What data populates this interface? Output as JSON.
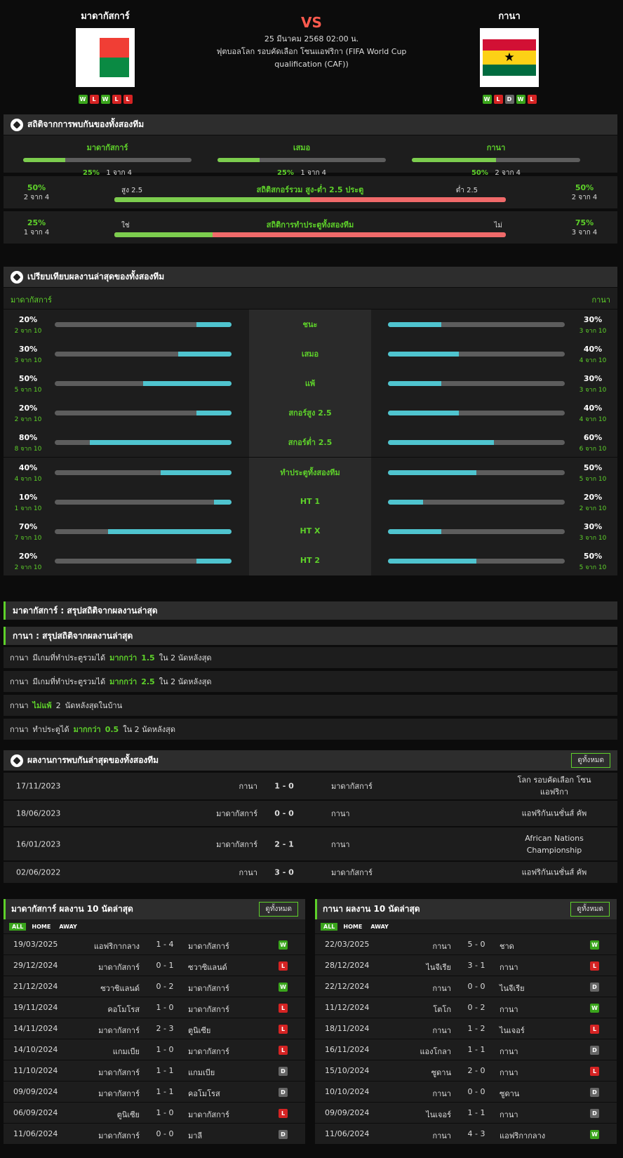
{
  "match": {
    "vs": "VS",
    "date": "25 มีนาคม 2568 02:00 น.",
    "competition": "ฟุตบอลโลก รอบคัดเลือก โซนแอฟริกา (FIFA World Cup qualification (CAF))",
    "home": {
      "name": "มาดากัสการ์",
      "form": [
        "W",
        "L",
        "W",
        "L",
        "L"
      ],
      "colors": [
        "#ffffff",
        "#f03e35",
        "#0a8a43"
      ]
    },
    "away": {
      "name": "กานา",
      "form": [
        "W",
        "L",
        "D",
        "W",
        "L"
      ],
      "colors": [
        "#d21034",
        "#fcd116",
        "#006b3f"
      ]
    }
  },
  "h2h_stats": {
    "title": "สถิติจากการพบกันของทั้งสองทีม",
    "cols": [
      {
        "label": "มาดากัสการ์",
        "pct": "25%",
        "frac": "1 จาก 4",
        "value": 25
      },
      {
        "label": "เสมอ",
        "pct": "25%",
        "frac": "1 จาก 4",
        "value": 25
      },
      {
        "label": "กานา",
        "pct": "50%",
        "frac": "2 จาก 4",
        "value": 50
      }
    ],
    "ou": {
      "title": "สถิติสกอร์รวม สูง-ต่ำ 2.5 ประตู",
      "left_label": "สูง 2.5",
      "right_label": "ต่ำ 2.5",
      "lp": "50%",
      "lf": "2 จาก 4",
      "rp": "50%",
      "rf": "2 จาก 4",
      "value": 50
    },
    "btts": {
      "title": "สถิติการทำประตูทั้งสองทีม",
      "left_label": "ใช่",
      "right_label": "ไม่",
      "lp": "25%",
      "lf": "1 จาก 4",
      "rp": "75%",
      "rf": "3 จาก 4",
      "value": 25
    }
  },
  "compare": {
    "title": "เปรียบเทียบผลงานล่าสุดของทั้งสองทีม",
    "home": "มาดากัสการ์",
    "away": "กานา",
    "rows": [
      {
        "label": "ชนะ",
        "lp": "20%",
        "lf": "2 จาก 10",
        "lv": 20,
        "rp": "30%",
        "rf": "3 จาก 10",
        "rv": 30
      },
      {
        "label": "เสมอ",
        "lp": "30%",
        "lf": "3 จาก 10",
        "lv": 30,
        "rp": "40%",
        "rf": "4 จาก 10",
        "rv": 40
      },
      {
        "label": "แพ้",
        "lp": "50%",
        "lf": "5 จาก 10",
        "lv": 50,
        "rp": "30%",
        "rf": "3 จาก 10",
        "rv": 30
      },
      {
        "label": "สกอร์สูง 2.5",
        "lp": "20%",
        "lf": "2 จาก 10",
        "lv": 20,
        "rp": "40%",
        "rf": "4 จาก 10",
        "rv": 40
      },
      {
        "label": "สกอร์ต่ำ 2.5",
        "lp": "80%",
        "lf": "8 จาก 10",
        "lv": 80,
        "rp": "60%",
        "rf": "6 จาก 10",
        "rv": 60
      },
      {
        "label": "ทำประตูทั้งสองทีม",
        "lp": "40%",
        "lf": "4 จาก 10",
        "lv": 40,
        "rp": "50%",
        "rf": "5 จาก 10",
        "rv": 50
      },
      {
        "label": "HT 1",
        "lp": "10%",
        "lf": "1 จาก 10",
        "lv": 10,
        "rp": "20%",
        "rf": "2 จาก 10",
        "rv": 20
      },
      {
        "label": "HT X",
        "lp": "70%",
        "lf": "7 จาก 10",
        "lv": 70,
        "rp": "30%",
        "rf": "3 จาก 10",
        "rv": 30
      },
      {
        "label": "HT 2",
        "lp": "20%",
        "lf": "2 จาก 10",
        "lv": 20,
        "rp": "50%",
        "rf": "5 จาก 10",
        "rv": 50
      }
    ]
  },
  "summary": {
    "home_title": "มาดากัสการ์ : สรุปสถิติจากผลงานล่าสุด",
    "away_title": "กานา : สรุปสถิติจากผลงานล่าสุด",
    "rows": [
      [
        "กานา",
        "มีเกมที่ทำประตูรวมได้",
        "มากกว่า",
        "1.5",
        "ใน 2 นัดหลังสุด"
      ],
      [
        "กานา",
        "มีเกมที่ทำประตูรวมได้",
        "มากกว่า",
        "2.5",
        "ใน 2 นัดหลังสุด"
      ],
      [
        "กานา",
        "",
        "ไม่แพ้",
        "2",
        "นัดหลังสุดในบ้าน"
      ],
      [
        "กานา",
        "ทำประตูได้",
        "มากกว่า",
        "0.5",
        "ใน 2 นัดหลังสุด"
      ]
    ]
  },
  "h2h_results": {
    "title": "ผลงานการพบกันล่าสุดของทั้งสองทีม",
    "view_all": "ดูทั้งหมด",
    "rows": [
      {
        "date": "17/11/2023",
        "home": "กานา",
        "score": "1 - 0",
        "away": "มาดากัสการ์",
        "comp": "โลก รอบคัดเลือก โซนแอฟริกา"
      },
      {
        "date": "18/06/2023",
        "home": "มาดากัสการ์",
        "score": "0 - 0",
        "away": "กานา",
        "comp": "แอฟริกันเนชั่นส์ คัพ"
      },
      {
        "date": "16/01/2023",
        "home": "มาดากัสการ์",
        "score": "2 - 1",
        "away": "กานา",
        "comp": "African Nations Championship"
      },
      {
        "date": "02/06/2022",
        "home": "กานา",
        "score": "3 - 0",
        "away": "มาดากัสการ์",
        "comp": "แอฟริกันเนชั่นส์ คัพ"
      }
    ]
  },
  "last10_home": {
    "title": "มาดากัสการ์ ผลงาน 10 นัดล่าสุด",
    "view_all": "ดูทั้งหมด",
    "tabs": [
      "ALL",
      "HOME",
      "AWAY"
    ],
    "rows": [
      [
        "19/03/2025",
        "แอฟริกากลาง",
        "1 - 4",
        "มาดากัสการ์",
        "W"
      ],
      [
        "29/12/2024",
        "มาดากัสการ์",
        "0 - 1",
        "ซวาซิแลนด์",
        "L"
      ],
      [
        "21/12/2024",
        "ซวาซิแลนด์",
        "0 - 2",
        "มาดากัสการ์",
        "W"
      ],
      [
        "19/11/2024",
        "คอโมโรส",
        "1 - 0",
        "มาดากัสการ์",
        "L"
      ],
      [
        "14/11/2024",
        "มาดากัสการ์",
        "2 - 3",
        "ตูนิเซีย",
        "L"
      ],
      [
        "14/10/2024",
        "แกมเบีย",
        "1 - 0",
        "มาดากัสการ์",
        "L"
      ],
      [
        "11/10/2024",
        "มาดากัสการ์",
        "1 - 1",
        "แกมเบีย",
        "D"
      ],
      [
        "09/09/2024",
        "มาดากัสการ์",
        "1 - 1",
        "คอโมโรส",
        "D"
      ],
      [
        "06/09/2024",
        "ตูนิเซีย",
        "1 - 0",
        "มาดากัสการ์",
        "L"
      ],
      [
        "11/06/2024",
        "มาดากัสการ์",
        "0 - 0",
        "มาลี",
        "D"
      ]
    ]
  },
  "last10_away": {
    "title": "กานา ผลงาน 10 นัดล่าสุด",
    "view_all": "ดูทั้งหมด",
    "tabs": [
      "ALL",
      "HOME",
      "AWAY"
    ],
    "rows": [
      [
        "22/03/2025",
        "กานา",
        "5 - 0",
        "ชาด",
        "W"
      ],
      [
        "28/12/2024",
        "ไนจีเรีย",
        "3 - 1",
        "กานา",
        "L"
      ],
      [
        "22/12/2024",
        "กานา",
        "0 - 0",
        "ไนจีเรีย",
        "D"
      ],
      [
        "11/12/2024",
        "โตโก",
        "0 - 2",
        "กานา",
        "W"
      ],
      [
        "18/11/2024",
        "กานา",
        "1 - 2",
        "ไนเจอร์",
        "L"
      ],
      [
        "16/11/2024",
        "แองโกลา",
        "1 - 1",
        "กานา",
        "D"
      ],
      [
        "15/10/2024",
        "ซูดาน",
        "2 - 0",
        "กานา",
        "L"
      ],
      [
        "10/10/2024",
        "กานา",
        "0 - 0",
        "ซูดาน",
        "D"
      ],
      [
        "09/09/2024",
        "ไนเจอร์",
        "1 - 1",
        "กานา",
        "D"
      ],
      [
        "11/06/2024",
        "กานา",
        "4 - 3",
        "แอฟริกากลาง",
        "W"
      ]
    ]
  }
}
